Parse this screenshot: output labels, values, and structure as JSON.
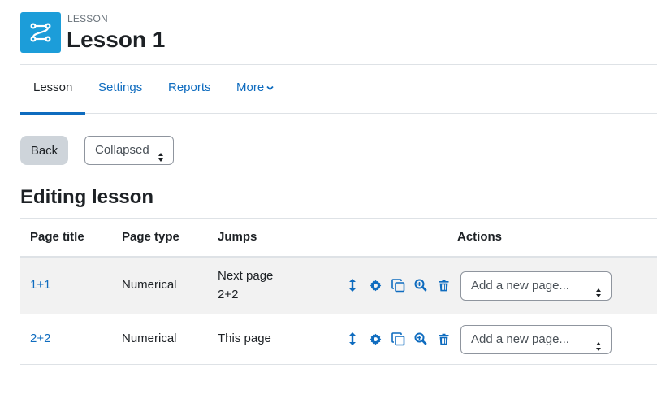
{
  "header": {
    "activity_type": "LESSON",
    "title": "Lesson 1",
    "icon": "lesson-icon"
  },
  "nav": {
    "tabs": [
      {
        "label": "Lesson",
        "active": true
      },
      {
        "label": "Settings",
        "active": false
      },
      {
        "label": "Reports",
        "active": false
      },
      {
        "label": "More",
        "active": false
      }
    ]
  },
  "controls": {
    "back_label": "Back",
    "view_select_value": "Collapsed"
  },
  "section_title": "Editing lesson",
  "table": {
    "headers": [
      "Page title",
      "Page type",
      "Jumps",
      "Actions"
    ],
    "rows": [
      {
        "title": "1+1",
        "type": "Numerical",
        "jumps": [
          "Next page",
          "2+2"
        ],
        "add_page_value": "Add a new page..."
      },
      {
        "title": "2+2",
        "type": "Numerical",
        "jumps": [
          "This page"
        ],
        "add_page_value": "Add a new page..."
      }
    ],
    "action_icons": [
      "move-icon",
      "gear-icon",
      "copy-icon",
      "zoom-in-icon",
      "trash-icon"
    ]
  },
  "colors": {
    "accent": "#0f6cbf",
    "activity_icon_bg": "#1c9dd9",
    "back_button_bg": "#ced4da",
    "row_highlight": "#f2f2f2"
  }
}
